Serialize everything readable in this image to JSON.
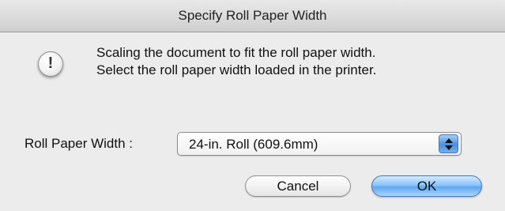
{
  "dialog": {
    "title": "Specify Roll Paper Width",
    "message_line1": "Scaling the document to fit the roll paper width.",
    "message_line2": "Select the roll paper width loaded in the printer.",
    "alert_icon": "exclamation-icon"
  },
  "roll_width": {
    "label": "Roll Paper Width :",
    "selected_value": "24-in. Roll (609.6mm)"
  },
  "buttons": {
    "cancel_label": "Cancel",
    "ok_label": "OK"
  },
  "colors": {
    "window_background": "#ececec",
    "default_button_accent": "#5fa8f1"
  }
}
